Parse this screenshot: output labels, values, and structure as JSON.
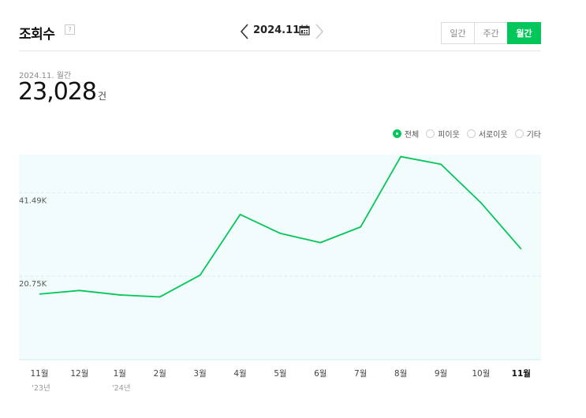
{
  "header": {
    "title": "조회수",
    "help_icon": "?",
    "period_label": "2024.11.",
    "view_toggle": [
      {
        "label": "일간",
        "active": false
      },
      {
        "label": "주간",
        "active": false
      },
      {
        "label": "월간",
        "active": true
      }
    ]
  },
  "summary": {
    "date_label": "2024.11. 월간",
    "total_value": "23,028",
    "total_unit": "건"
  },
  "legend": [
    {
      "label": "전체",
      "checked": true
    },
    {
      "label": "피이웃",
      "checked": false
    },
    {
      "label": "서로이웃",
      "checked": false
    },
    {
      "label": "기타",
      "checked": false
    }
  ],
  "colors": {
    "accent": "#03c75a",
    "plot_background": "#f3fcfd",
    "grid": "#d6eef0"
  },
  "chart_data": {
    "type": "line",
    "categories": [
      "11월",
      "12월",
      "1월",
      "2월",
      "3월",
      "4월",
      "5월",
      "6월",
      "7월",
      "8월",
      "9월",
      "10월",
      "11월"
    ],
    "year_labels": [
      "'23년",
      "",
      "'24년",
      "",
      "",
      "",
      "",
      "",
      "",
      "",
      "",
      "",
      ""
    ],
    "highlighted_category_index": 12,
    "series": [
      {
        "values": [
          16300,
          17200,
          16100,
          15600,
          21000,
          36100,
          31400,
          29100,
          33000,
          50500,
          48600,
          39000,
          27500
        ]
      }
    ],
    "y_ticks": [
      {
        "value": 20750,
        "label": "20.75K"
      },
      {
        "value": 41490,
        "label": "41.49K"
      }
    ],
    "ylim": [
      0,
      51000
    ],
    "grid": true,
    "legend_position": "top-right"
  }
}
